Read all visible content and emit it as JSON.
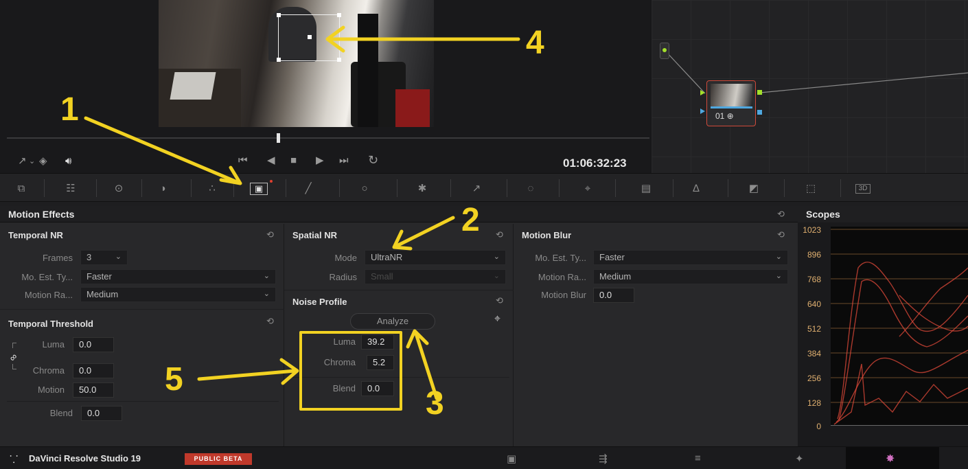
{
  "viewer": {
    "timecode": "01:06:32:23"
  },
  "node": {
    "label": "01 ⊕"
  },
  "colors": {
    "annotation": "#f2d222",
    "node_border": "#d04a3a",
    "accent_green": "#a3e02a",
    "accent_blue": "#4fa8e0",
    "beta_badge": "#c0392b"
  },
  "palette_icons": [
    "camera-raw-icon",
    "color-match-icon",
    "primaries-icon",
    "hdr-icon",
    "rgb-mixer-icon",
    "motion-effects-icon",
    "curves-icon",
    "color-warper-icon",
    "qualifier-icon",
    "picker-icon",
    "window-icon",
    "tracker-icon",
    "magic-mask-icon",
    "blur-icon",
    "key-icon",
    "sizing-icon",
    "3d-icon"
  ],
  "panel": {
    "title": "Motion Effects"
  },
  "temporal_nr": {
    "title": "Temporal NR",
    "frames_label": "Frames",
    "frames_value": "3",
    "mo_est_label": "Mo. Est. Ty...",
    "mo_est_value": "Faster",
    "motion_range_label": "Motion Ra...",
    "motion_range_value": "Medium"
  },
  "temporal_threshold": {
    "title": "Temporal Threshold",
    "luma_label": "Luma",
    "luma_value": "0.0",
    "chroma_label": "Chroma",
    "chroma_value": "0.0",
    "motion_label": "Motion",
    "motion_value": "50.0",
    "blend_label": "Blend",
    "blend_value": "0.0"
  },
  "spatial_nr": {
    "title": "Spatial NR",
    "mode_label": "Mode",
    "mode_value": "UltraNR",
    "radius_label": "Radius",
    "radius_value": "Small"
  },
  "noise_profile": {
    "title": "Noise Profile",
    "analyze_label": "Analyze",
    "luma_label": "Luma",
    "luma_value": "39.2",
    "chroma_label": "Chroma",
    "chroma_value": "5.2",
    "blend_label": "Blend",
    "blend_value": "0.0"
  },
  "motion_blur": {
    "title": "Motion Blur",
    "mo_est_label": "Mo. Est. Ty...",
    "mo_est_value": "Faster",
    "motion_range_label": "Motion Ra...",
    "motion_range_value": "Medium",
    "blur_label": "Motion Blur",
    "blur_value": "0.0"
  },
  "scopes": {
    "title": "Scopes",
    "ticks": [
      "1023",
      "896",
      "768",
      "640",
      "512",
      "384",
      "256",
      "128",
      "0"
    ]
  },
  "status": {
    "app_name": "DaVinci Resolve Studio 19",
    "badge": "PUBLIC BETA"
  },
  "annotations": {
    "one": "1",
    "two": "2",
    "three": "3",
    "four": "4",
    "five": "5"
  }
}
